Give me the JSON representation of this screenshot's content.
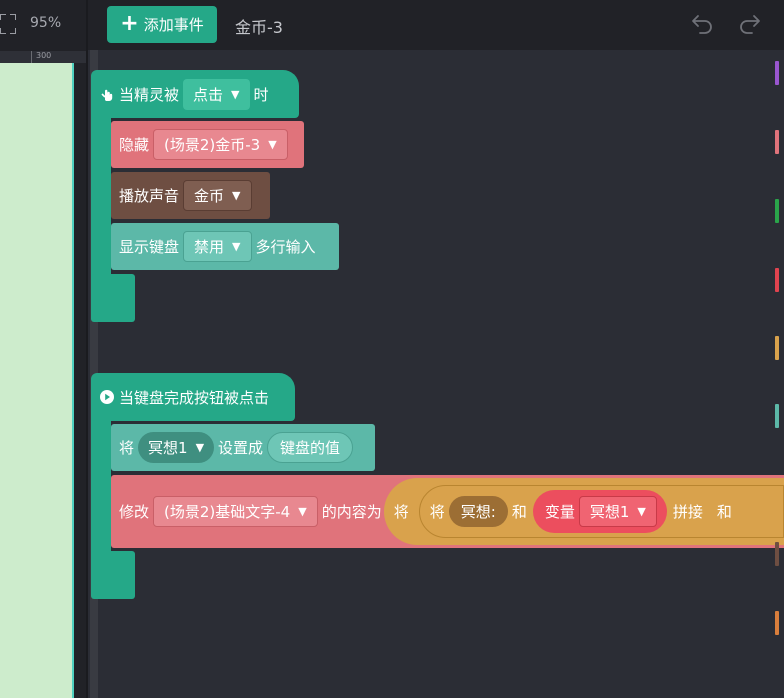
{
  "left_panel": {
    "zoom": "95%",
    "ruler_label": "300"
  },
  "header": {
    "add_event_label": "添加事件",
    "object_name": "金币-3"
  },
  "event1": {
    "hat": {
      "prefix": "当精灵被",
      "dropdown": "点击",
      "suffix": "时"
    },
    "hide": {
      "label": "隐藏",
      "target": "(场景2)金币-3"
    },
    "sound": {
      "label": "播放声音",
      "sound": "金币"
    },
    "keyboard": {
      "label": "显示键盘",
      "mode": "禁用",
      "suffix": "多行输入"
    }
  },
  "event2": {
    "hat": {
      "label": "当键盘完成按钮被点击"
    },
    "setvar": {
      "prefix": "将",
      "variable": "冥想1",
      "middle": "设置成",
      "value": "键盘的值"
    },
    "modify": {
      "prefix": "修改",
      "target": "(场景2)基础文字-4",
      "middle": "的内容为",
      "join_outer": "将",
      "join_inner": "将",
      "text_value": "冥想:",
      "and_label": "和",
      "var_label": "变量",
      "var_name": "冥想1",
      "concat_label": "拼接",
      "trail_label": "和"
    }
  },
  "colors": {
    "event_green": "#25a888",
    "looks_pink": "#e0737b",
    "sound_brown": "#6e4e42",
    "sensing_teal": "#5cb8a8",
    "operator_orange": "#d9a24c",
    "variable_red": "#ec4e5e"
  }
}
